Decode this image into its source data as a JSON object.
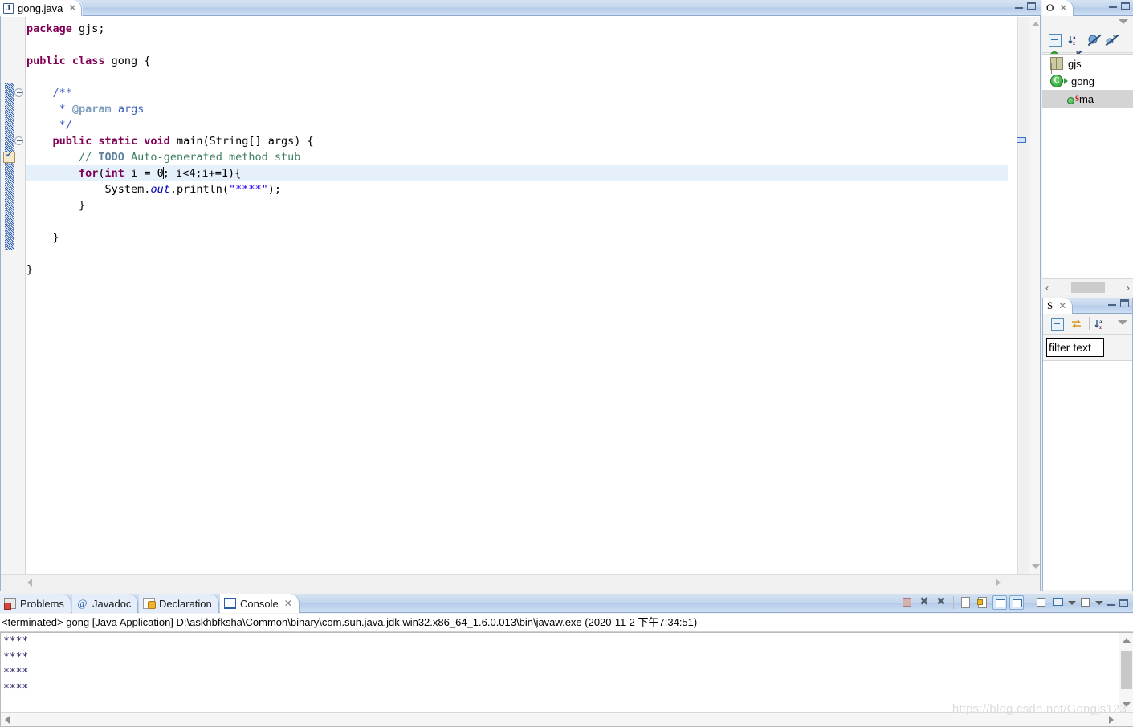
{
  "editor": {
    "tab": {
      "label": "gong.java",
      "icon": "java-file-icon",
      "close": "✕"
    },
    "window_controls": {
      "minimize": "minimize-icon",
      "maximize": "maximize-icon"
    },
    "code_lines": [
      [
        {
          "t": "package",
          "c": "kw"
        },
        {
          "t": " gjs;",
          "c": "pln"
        }
      ],
      [],
      [
        {
          "t": "public class",
          "c": "kw"
        },
        {
          "t": " gong {",
          "c": "pln"
        }
      ],
      [],
      [
        {
          "t": "    /**",
          "c": "jdoc"
        }
      ],
      [
        {
          "t": "     * ",
          "c": "jdoc"
        },
        {
          "t": "@param",
          "c": "jtag"
        },
        {
          "t": " args",
          "c": "jdoc"
        }
      ],
      [
        {
          "t": "     */",
          "c": "jdoc"
        }
      ],
      [
        {
          "t": "    public static void",
          "c": "kw"
        },
        {
          "t": " main(String[] args) {",
          "c": "pln"
        }
      ],
      [
        {
          "t": "        // ",
          "c": "cmt"
        },
        {
          "t": "TODO",
          "c": "todo"
        },
        {
          "t": " Auto-generated method stub",
          "c": "cmt"
        }
      ],
      [
        {
          "t": "        for",
          "c": "kw"
        },
        {
          "t": "(",
          "c": "pln"
        },
        {
          "t": "int",
          "c": "kw"
        },
        {
          "t": " i = 0",
          "c": "pln"
        },
        {
          "t": "|",
          "c": "caret"
        },
        {
          "t": "; i<4;i+=1){",
          "c": "pln"
        }
      ],
      [
        {
          "t": "            System.",
          "c": "pln"
        },
        {
          "t": "out",
          "c": "fld"
        },
        {
          "t": ".println(",
          "c": "pln"
        },
        {
          "t": "\"****\"",
          "c": "str"
        },
        {
          "t": ");",
          "c": "pln"
        }
      ],
      [
        {
          "t": "        }",
          "c": "pln"
        }
      ],
      [],
      [
        {
          "t": "    }",
          "c": "pln"
        }
      ],
      [],
      [
        {
          "t": "}",
          "c": "pln"
        }
      ]
    ],
    "highlighted_line_index": 9
  },
  "outline": {
    "tab_label": "O",
    "tab_close": "✕",
    "toolbar": [
      "collapse-all-icon",
      "sort-az-icon",
      "hide-fields-icon",
      "hide-static-icon",
      "hide-non-public-icon",
      "hide-local-types-icon"
    ],
    "tree": [
      {
        "label": "gjs",
        "icon": "package-icon",
        "indent": 0,
        "selected": false,
        "expandable": false
      },
      {
        "label": "gong",
        "icon": "java-class-icon",
        "indent": 0,
        "selected": false,
        "expandable": true
      },
      {
        "label": "ma",
        "icon": "static-method-icon",
        "indent": 1,
        "selected": true,
        "expandable": false
      }
    ],
    "hscroll": {
      "left": "‹",
      "right": "›"
    }
  },
  "search_panel": {
    "tab_label": "S",
    "tab_close": "✕",
    "toolbar": [
      "collapse-all-icon",
      "link-with-editor-icon",
      "sort-az-icon",
      "view-menu-icon"
    ],
    "filter_value": "filter text",
    "filter_placeholder": "filter text"
  },
  "bottom": {
    "tabs": [
      {
        "label": "Problems",
        "icon": "problems-icon",
        "active": false
      },
      {
        "label": "Javadoc",
        "icon": "javadoc-icon",
        "active": false
      },
      {
        "label": "Declaration",
        "icon": "declaration-icon",
        "active": false
      },
      {
        "label": "Console",
        "icon": "console-icon",
        "active": true,
        "close": "✕"
      }
    ],
    "toolbar": [
      "terminate-icon",
      "remove-launch-icon",
      "remove-all-terminated-icon",
      "clear-console-icon",
      "scroll-lock-icon",
      "show-console-on-output-icon",
      "show-console-on-error-icon",
      "pin-console-icon",
      "display-console-icon",
      "display-console-dropdown-icon",
      "open-console-icon",
      "open-console-dropdown-icon",
      "minimize-icon",
      "maximize-icon"
    ],
    "console_header": "<terminated> gong [Java Application] D:\\askhbfksha\\Common\\binary\\com.sun.java.jdk.win32.x86_64_1.6.0.013\\bin\\javaw.exe (2020-11-2 下午7:34:51)",
    "console_output": "****\n****\n****\n****"
  },
  "watermark": "https://blog.csdn.net/Gongjs123"
}
